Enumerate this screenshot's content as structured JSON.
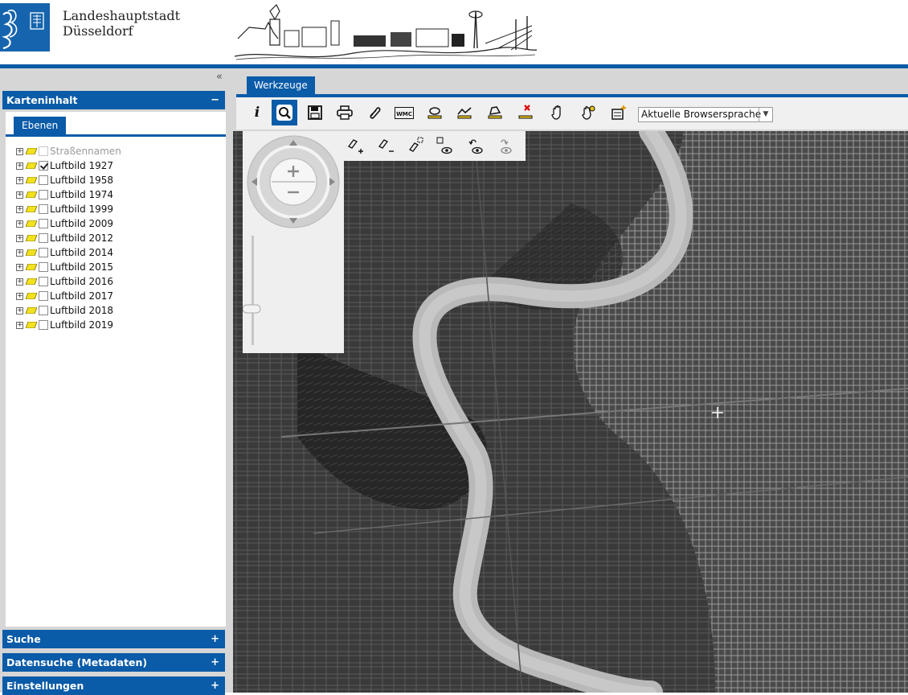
{
  "header": {
    "city_line1": "Landeshauptstadt",
    "city_line2": "Düsseldorf",
    "logo_icon": "coat-of-arms-icon",
    "banner": "skyline-drawing"
  },
  "sidebar": {
    "collapse_icon": "double-chevron-left-icon",
    "karteninhalt": {
      "title": "Karteninhalt",
      "sign": "−",
      "tab_label": "Ebenen",
      "layers": [
        {
          "label": "Straßennamen",
          "checked": false,
          "disabled": true
        },
        {
          "label": "Luftbild 1927",
          "checked": true,
          "disabled": false
        },
        {
          "label": "Luftbild 1958",
          "checked": false,
          "disabled": false
        },
        {
          "label": "Luftbild 1974",
          "checked": false,
          "disabled": false
        },
        {
          "label": "Luftbild 1999",
          "checked": false,
          "disabled": false
        },
        {
          "label": "Luftbild 2009",
          "checked": false,
          "disabled": false
        },
        {
          "label": "Luftbild 2012",
          "checked": false,
          "disabled": false
        },
        {
          "label": "Luftbild 2014",
          "checked": false,
          "disabled": false
        },
        {
          "label": "Luftbild 2015",
          "checked": false,
          "disabled": false
        },
        {
          "label": "Luftbild 2016",
          "checked": false,
          "disabled": false
        },
        {
          "label": "Luftbild 2017",
          "checked": false,
          "disabled": false
        },
        {
          "label": "Luftbild 2018",
          "checked": false,
          "disabled": false
        },
        {
          "label": "Luftbild 2019",
          "checked": false,
          "disabled": false
        }
      ]
    },
    "suche": {
      "title": "Suche",
      "sign": "+"
    },
    "datensuche": {
      "title": "Datensuche (Metadaten)",
      "sign": "+"
    },
    "einstellungen": {
      "title": "Einstellungen",
      "sign": "+"
    }
  },
  "toolbar": {
    "tab_label": "Werkzeuge",
    "info_label": "i",
    "wmc_label": "WMC",
    "language_select": "Aktuelle Browsersprache"
  },
  "colors": {
    "brand_blue": "#0a5ba8",
    "panel_grey": "#d6d6d6"
  }
}
